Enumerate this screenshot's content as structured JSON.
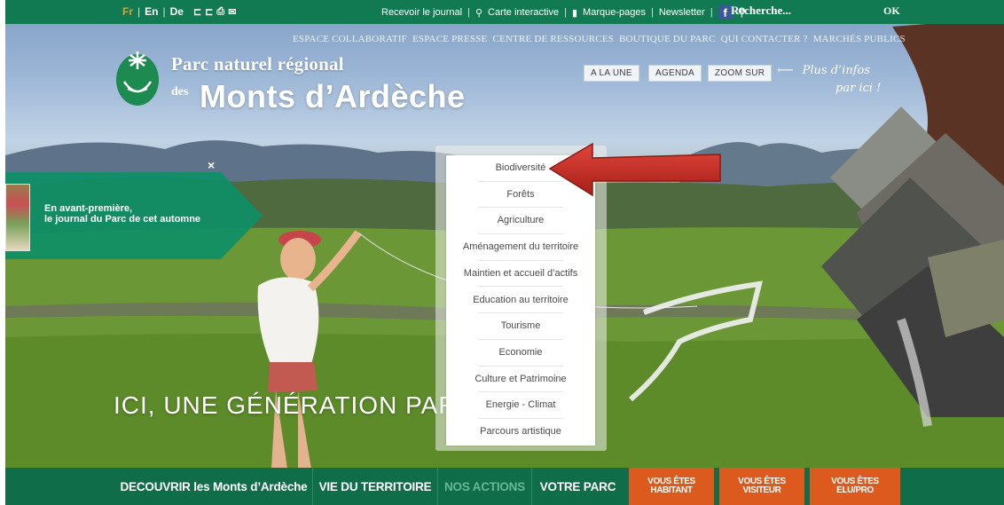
{
  "topbar": {
    "languages": [
      "Fr",
      "En",
      "De"
    ],
    "separator": "|",
    "tool_icons": [
      "font-size-decrease-icon",
      "font-size-increase-icon",
      "print-icon",
      "email-icon"
    ],
    "links": [
      "Recevoir le journal",
      "Carte interactive",
      "Marque-pages",
      "Newsletter"
    ],
    "search_placeholder": "Recherche...",
    "ok_label": "OK"
  },
  "secondary_nav": [
    "ESPACE COLLABORATIF",
    "ESPACE PRESSE",
    "CENTRE DE RESSOURCES",
    "BOUTIQUE DU PARC",
    "QUI CONTACTER ?",
    "MARCHÉS PUBLICS"
  ],
  "logo": {
    "line1": "Parc naturel régional",
    "des": "des",
    "line2": "Monts d’Ardèche"
  },
  "quick_buttons": [
    "A LA UNE",
    "AGENDA",
    "ZOOM SUR"
  ],
  "plus_info": {
    "line1": "Plus d’infos",
    "line2": "par ici !"
  },
  "promo": {
    "close": "×",
    "line1": "En avant-première,",
    "line2": "le journal du Parc de cet automne"
  },
  "slogan": "ICI, UNE GÉNÉRATION PARC",
  "dropdown": {
    "items": [
      "Biodiversité",
      "Forêts",
      "Agriculture",
      "Aménagement du territoire",
      "Maintien et accueil d’actifs",
      "Education au territoire",
      "Tourisme",
      "Economie",
      "Culture et Patrimoine",
      "Energie - Climat",
      "Parcours artistique"
    ]
  },
  "main_nav": {
    "decouvrir": "DECOUVRIR les Monts d’Ardèche",
    "vie": "VIE DU TERRITOIRE",
    "actions": "NOS ACTIONS",
    "parc": "VOTRE PARC",
    "vous_etes": "VOUS ÊTES",
    "habitant": "HABITANT",
    "visiteur": "VISITEUR",
    "elu": "ELU/PRO"
  },
  "colors": {
    "brand_green": "#0f6d4a",
    "topbar_green": "#117a52",
    "orange": "#dc5a1d",
    "arrow_red": "#c7281f",
    "lang_active": "#f19a1c"
  }
}
